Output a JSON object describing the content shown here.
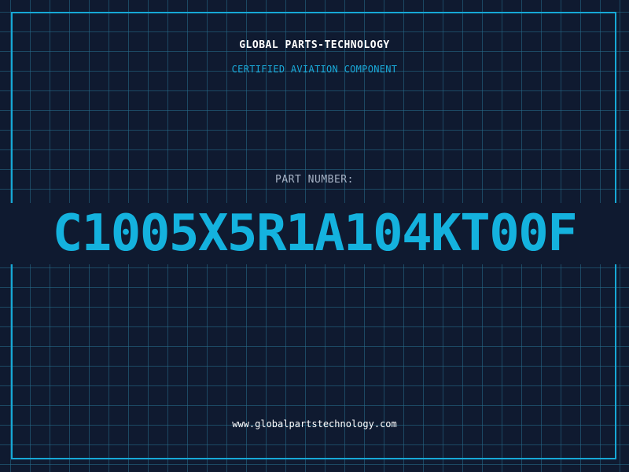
{
  "header": {
    "company": "GLOBAL PARTS-TECHNOLOGY",
    "tagline": "CERTIFIED AVIATION COMPONENT"
  },
  "part": {
    "label": "PART NUMBER:",
    "number": "C1005X5R1A104KT00F"
  },
  "footer": {
    "url": "www.globalpartstechnology.com"
  },
  "colors": {
    "background": "#0f1a30",
    "grid": "#266e8c",
    "accent": "#16a8d6",
    "text_primary": "#ffffff",
    "text_muted": "#a7b3c6"
  }
}
